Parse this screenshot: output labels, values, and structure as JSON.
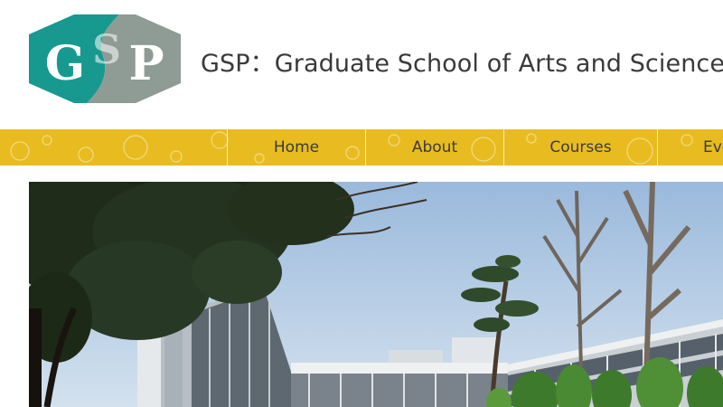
{
  "logo": {
    "letter_left": "G",
    "letter_middle": "S",
    "letter_right": "P",
    "colors": {
      "teal": "#17998f",
      "gray": "#8f9b95"
    }
  },
  "header": {
    "title": "GSP：Graduate School of Arts and Sciences,"
  },
  "nav": {
    "bar_color": "#e8bc20",
    "items": [
      {
        "label": "Home"
      },
      {
        "label": "About"
      },
      {
        "label": "Courses"
      },
      {
        "label": "Eve"
      }
    ]
  },
  "hero": {
    "description_icon": "campus-photo"
  }
}
